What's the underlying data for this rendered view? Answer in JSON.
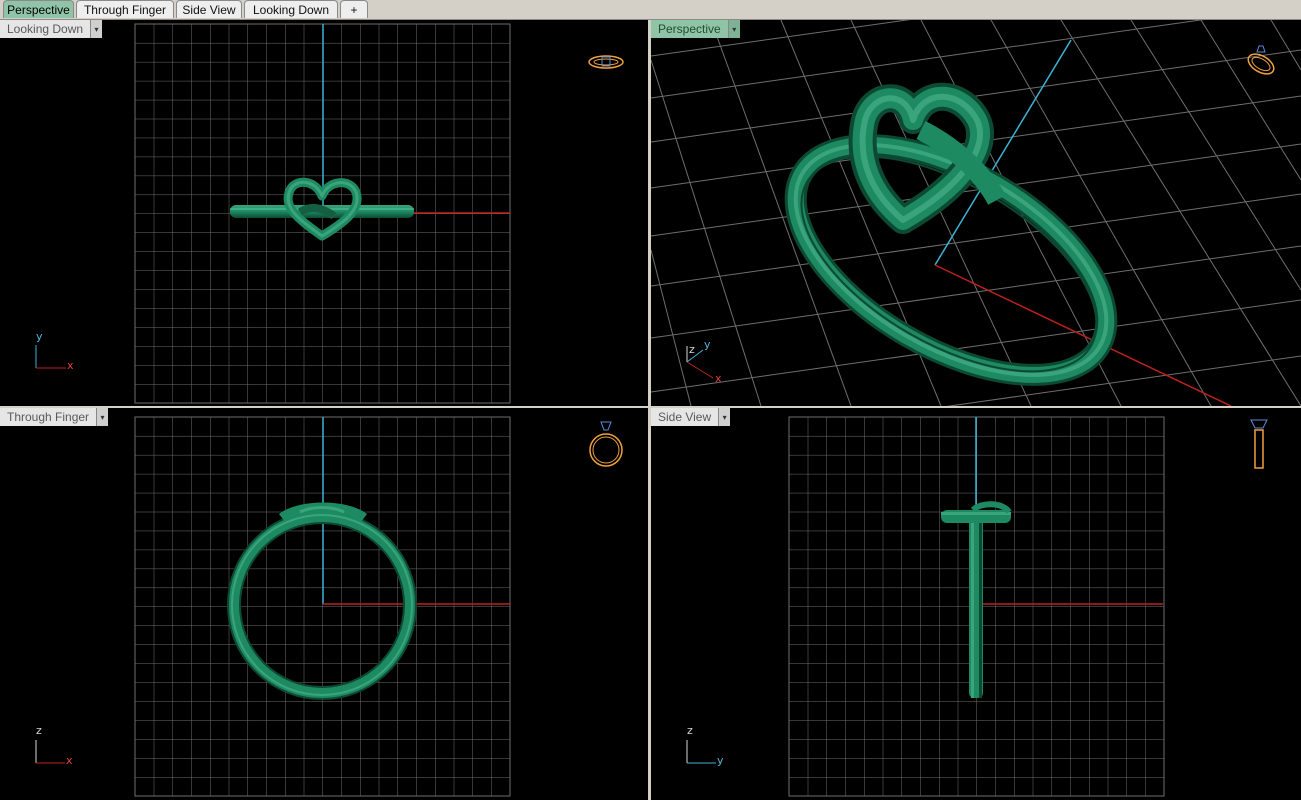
{
  "tabs": [
    {
      "label": "Perspective",
      "active": true
    },
    {
      "label": "Through Finger",
      "active": false
    },
    {
      "label": "Side View",
      "active": false
    },
    {
      "label": "Looking Down",
      "active": false
    }
  ],
  "add_tab_symbol": "+",
  "viewports": {
    "top_left": {
      "label": "Looking Down",
      "icon": "ring-top-view-icon",
      "axes": [
        "y",
        "x"
      ]
    },
    "top_right": {
      "label": "Perspective",
      "icon": "ring-perspective-icon",
      "axes": [
        "z",
        "y",
        "x"
      ]
    },
    "bottom_left": {
      "label": "Through Finger",
      "icon": "ring-front-view-icon",
      "axes": [
        "z",
        "x"
      ]
    },
    "bottom_right": {
      "label": "Side View",
      "icon": "ring-side-view-icon",
      "axes": [
        "z",
        "y"
      ]
    }
  },
  "dropdown_symbol": "▾",
  "colors": {
    "background": "#000000",
    "grid": "#6e6e6e",
    "model": "#1f8a63",
    "axis_x": "#c0211c",
    "axis_y": "#3cb4d4",
    "tab_active": "#8fc4a6",
    "gizmo_icon": "#f0a040"
  }
}
